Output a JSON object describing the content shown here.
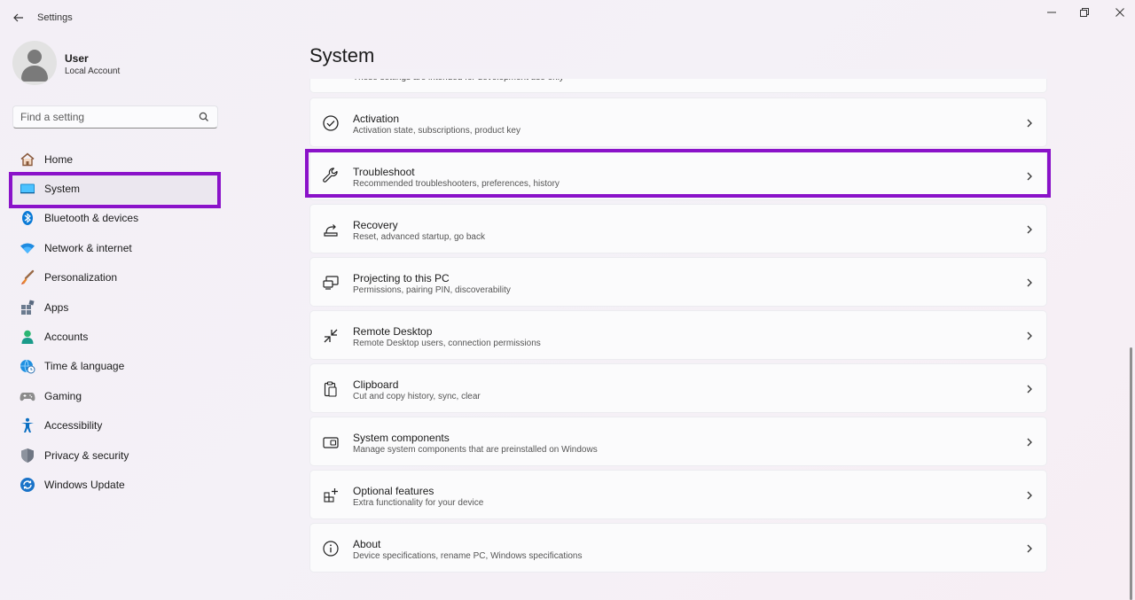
{
  "window": {
    "title": "Settings",
    "controls": {
      "minimize": "minimize-icon",
      "maximize": "restore-icon",
      "close": "close-icon"
    }
  },
  "user": {
    "name": "User",
    "account_type": "Local Account"
  },
  "search": {
    "placeholder": "Find a setting"
  },
  "sidebar": {
    "selected": "System",
    "items": [
      {
        "label": "Home",
        "icon": "home-icon"
      },
      {
        "label": "System",
        "icon": "system-icon"
      },
      {
        "label": "Bluetooth & devices",
        "icon": "bluetooth-icon"
      },
      {
        "label": "Network & internet",
        "icon": "wifi-icon"
      },
      {
        "label": "Personalization",
        "icon": "brush-icon"
      },
      {
        "label": "Apps",
        "icon": "apps-icon"
      },
      {
        "label": "Accounts",
        "icon": "accounts-icon"
      },
      {
        "label": "Time & language",
        "icon": "globe-clock-icon"
      },
      {
        "label": "Gaming",
        "icon": "gamepad-icon"
      },
      {
        "label": "Accessibility",
        "icon": "accessibility-icon"
      },
      {
        "label": "Privacy & security",
        "icon": "shield-icon"
      },
      {
        "label": "Windows Update",
        "icon": "update-icon"
      }
    ]
  },
  "main": {
    "page_title": "System",
    "cut_off_subtitle": "These settings are intended for development use only",
    "cards": [
      {
        "title": "Activation",
        "subtitle": "Activation state, subscriptions, product key",
        "icon": "checkmark-circle-icon"
      },
      {
        "title": "Troubleshoot",
        "subtitle": "Recommended troubleshooters, preferences, history",
        "icon": "wrench-icon"
      },
      {
        "title": "Recovery",
        "subtitle": "Reset, advanced startup, go back",
        "icon": "recovery-icon"
      },
      {
        "title": "Projecting to this PC",
        "subtitle": "Permissions, pairing PIN, discoverability",
        "icon": "projecting-icon"
      },
      {
        "title": "Remote Desktop",
        "subtitle": "Remote Desktop users, connection permissions",
        "icon": "remote-desktop-icon"
      },
      {
        "title": "Clipboard",
        "subtitle": "Cut and copy history, sync, clear",
        "icon": "clipboard-icon"
      },
      {
        "title": "System components",
        "subtitle": "Manage system components that are preinstalled on Windows",
        "icon": "components-icon"
      },
      {
        "title": "Optional features",
        "subtitle": "Extra functionality for your device",
        "icon": "optional-features-icon"
      },
      {
        "title": "About",
        "subtitle": "Device specifications, rename PC, Windows specifications",
        "icon": "info-icon"
      }
    ]
  },
  "colors": {
    "highlight": "#8a12c9",
    "accent": "#0067c0"
  }
}
